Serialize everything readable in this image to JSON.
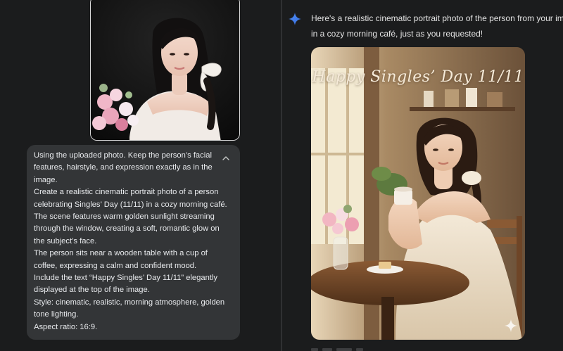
{
  "user_message": {
    "image_alt": "uploaded portrait photo",
    "prompt_lines": [
      "Using the uploaded photo. Keep the person’s facial",
      "features, hairstyle, and expression exactly as in the",
      "image.",
      "Create a realistic cinematic portrait photo of a person",
      "celebrating Singles’ Day (11/11) in a cozy morning café.",
      "The scene features warm golden sunlight streaming",
      "through the window, creating a soft, romantic glow on",
      "the subject’s face.",
      "The person sits near a wooden table with a cup of",
      "coffee, expressing a calm and confident mood.",
      "Include the text “Happy Singles’ Day 11/11” elegantly",
      "displayed at the top of the image.",
      "Style: cinematic, realistic, morning atmosphere, golden",
      "tone lighting.",
      "Aspect ratio: 16:9."
    ]
  },
  "response": {
    "lines": [
      "Here's a realistic cinematic portrait photo of the person from your image, c",
      "in a cozy morning café, just as you requested!"
    ],
    "image_overlay_text": "Happy Singles’ Day 11/11"
  },
  "colors": {
    "background": "#1b1c1d",
    "prompt_bubble": "#333537",
    "accent_sparkle": "#4c8df6"
  },
  "icons": {
    "collapse": "chevron-up-icon",
    "assistant": "sparkle-icon",
    "image_badge": "sparkle-icon"
  }
}
